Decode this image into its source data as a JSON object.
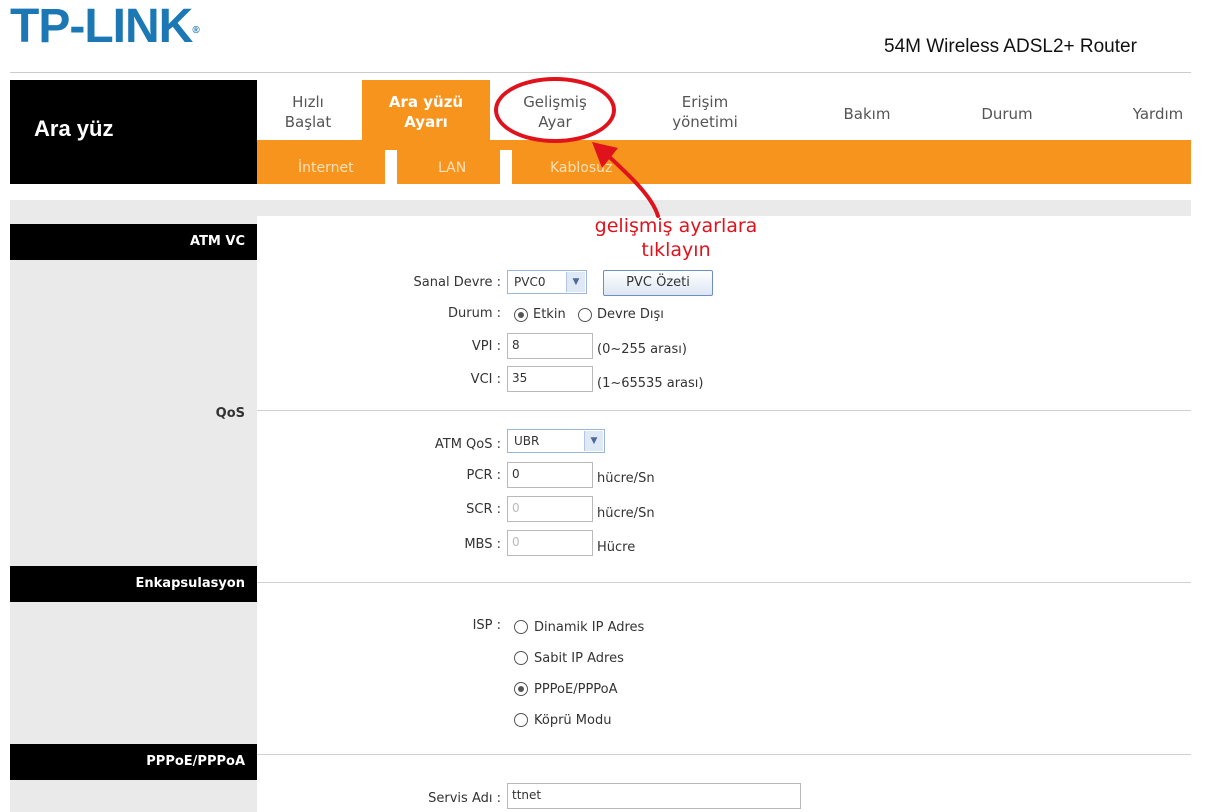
{
  "header": {
    "logo_text": "TP-LINK",
    "logo_mark": "®",
    "model": "54M Wireless ADSL2+ Router"
  },
  "page_title": "Ara yüz",
  "nav": {
    "items": [
      {
        "line1": "Hızlı",
        "line2": "Başlat"
      },
      {
        "line1": "Ara yüzü",
        "line2": "Ayarı",
        "active": true
      },
      {
        "line1": "Gelişmiş",
        "line2": "Ayar"
      },
      {
        "line1": "Erişim",
        "line2": "yönetimi"
      },
      {
        "line1": "Bakım"
      },
      {
        "line1": "Durum"
      },
      {
        "line1": "Yardım"
      }
    ]
  },
  "subnav": {
    "items": [
      "İnternet",
      "LAN",
      "Kablosuz"
    ]
  },
  "annotation": {
    "line1": "gelişmiş ayarlara",
    "line2": "tıklayın"
  },
  "sections": {
    "atm_vc": "ATM VC",
    "qos": "QoS",
    "encap": "Enkapsulasyon",
    "pppoe": "PPPoE/PPPoA"
  },
  "form": {
    "virtual_circuit": {
      "label": "Sanal Devre :",
      "value": "PVC0",
      "summary_button": "PVC Özeti"
    },
    "status": {
      "label": "Durum :",
      "opt_enabled": "Etkin",
      "opt_disabled": "Devre Dışı"
    },
    "vpi": {
      "label": "VPI :",
      "value": "8",
      "hint": "(0~255 arası)"
    },
    "vci": {
      "label": "VCI :",
      "value": "35",
      "hint": "(1~65535 arası)"
    },
    "atm_qos": {
      "label": "ATM QoS :",
      "value": "UBR"
    },
    "pcr": {
      "label": "PCR :",
      "value": "0",
      "unit": "hücre/Sn"
    },
    "scr": {
      "label": "SCR :",
      "value": "0",
      "unit": "hücre/Sn"
    },
    "mbs": {
      "label": "MBS :",
      "value": "0",
      "unit": "Hücre"
    },
    "isp": {
      "label": "ISP :",
      "options": [
        "Dinamik IP Adres",
        "Sabit IP Adres",
        "PPPoE/PPPoA",
        "Köprü Modu"
      ],
      "selected": "PPPoE/PPPoA"
    },
    "service_name": {
      "label": "Servis Adı :",
      "value": "ttnet"
    }
  },
  "colors": {
    "brand_blue": "#1b78b5",
    "nav_orange": "#f7941e",
    "annotation_red": "#e0121c"
  }
}
